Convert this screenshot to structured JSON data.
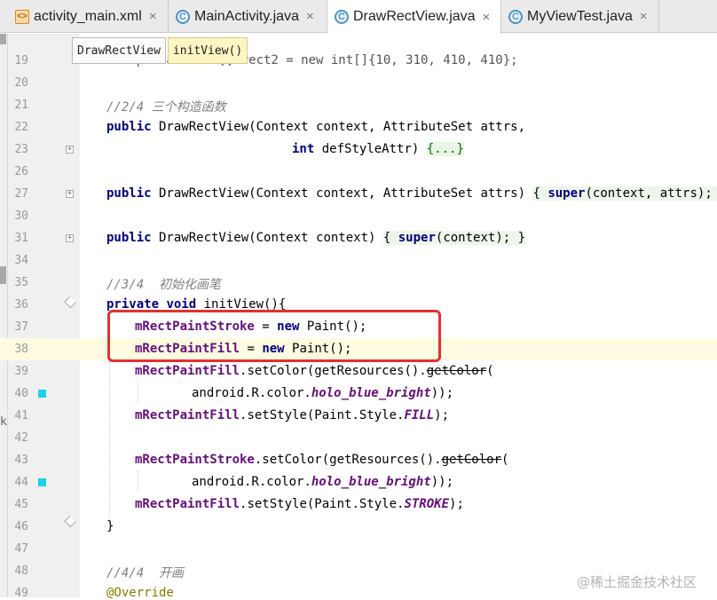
{
  "tabs": [
    {
      "label": "activity_main.xml",
      "icon": "xml-file-icon",
      "active": false
    },
    {
      "label": "MainActivity.java",
      "icon": "class-file-icon",
      "active": false
    },
    {
      "label": "DrawRectView.java",
      "icon": "class-file-icon",
      "active": true
    },
    {
      "label": "MyViewTest.java",
      "icon": "class-file-icon",
      "active": false
    }
  ],
  "tab_close_glyph": "×",
  "breadcrumb": [
    "DrawRectView",
    "initView()"
  ],
  "line_numbers": [
    "19",
    "20",
    "21",
    "22",
    "23",
    "26",
    "27",
    "30",
    "31",
    "34",
    "35",
    "36",
    "37",
    "38",
    "39",
    "40",
    "41",
    "42",
    "43",
    "44",
    "45",
    "46",
    "47",
    "48",
    "49"
  ],
  "fold_glyph": "+",
  "code": {
    "l19": {
      "text": "    private int[] rect2 = new int[]{10, 310, 410, 410};"
    },
    "l21": "//2/4 三个构造函数",
    "l22": {
      "kw": "public",
      "rest": " DrawRectView(Context context, AttributeSet attrs,"
    },
    "l23": {
      "kw": "int",
      "rest": " defStyleAttr) ",
      "fold": "{...}"
    },
    "l27": {
      "kw": "public",
      "rest": " DrawRectView(Context context, AttributeSet attrs) ",
      "ob": "{ ",
      "super": "super",
      "args": "(context, attrs); ",
      "cb": "}"
    },
    "l31": {
      "kw": "public",
      "rest": " DrawRectView(Context context) ",
      "ob": "{ ",
      "super": "super",
      "args": "(context); ",
      "cb": "}"
    },
    "l35": "//3/4  初始化画笔",
    "l36": {
      "kw1": "private",
      "kw2": "void",
      "rest": " initView(){"
    },
    "l37": {
      "field": "mRectPaintStroke",
      "eq": " = ",
      "kw": "new",
      "rest": " Paint();"
    },
    "l38": {
      "field": "mRectPaintFill",
      "eq": " = ",
      "kw": "new",
      "rest": " Paint();"
    },
    "l39": {
      "field": "mRectPaintFill",
      "rest": ".setColor(getResources().",
      "dep": "getColor",
      "tail": "("
    },
    "l40": {
      "pre": "android.R.color.",
      "sfield": "holo_blue_bright",
      "tail": "));"
    },
    "l41": {
      "field": "mRectPaintFill",
      "rest": ".setStyle(Paint.Style.",
      "sfield": "FILL",
      "tail": ");"
    },
    "l43": {
      "field": "mRectPaintStroke",
      "rest": ".setColor(getResources().",
      "dep": "getColor",
      "tail": "("
    },
    "l44": {
      "pre": "android.R.color.",
      "sfield": "holo_blue_bright",
      "tail": "));"
    },
    "l45": {
      "field": "mRectPaintFill",
      "rest": ".setStyle(Paint.Style.",
      "sfield": "STROKE",
      "tail": ");"
    },
    "l46": "}",
    "l48": "//4/4  开画",
    "l49": "@Override"
  },
  "watermark": "@稀土掘金技术社区",
  "left_edge_char": "k",
  "colors": {
    "keyword": "#000080",
    "field": "#660e7a",
    "comment": "#808080",
    "highlight_box": "#e53030",
    "bookmark": "#1bd0ea"
  }
}
